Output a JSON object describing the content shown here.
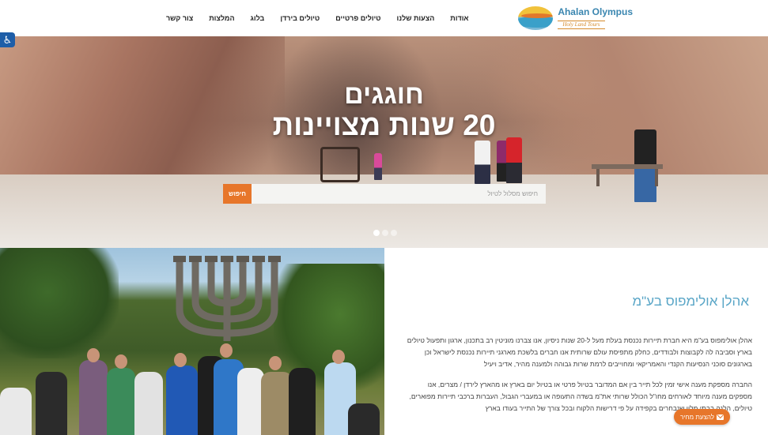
{
  "header": {
    "logo_title": "Ahalan Olympus",
    "logo_subtitle": "Holy Land Tours",
    "nav": [
      "אודות",
      "הצעות שלנו",
      "טיולים פרטיים",
      "טיולים בירדן",
      "בלוג",
      "המלצות",
      "צור קשר"
    ]
  },
  "hero": {
    "title_line1": "חוגגים",
    "title_line2": "20 שנות מצויינות",
    "search_placeholder": "חיפוש מסלול לטיול",
    "search_button": "חיפוש",
    "slides_count": 3,
    "active_slide": 1
  },
  "about": {
    "title": "אהלן אולימפוס בע\"מ",
    "p1": "אהלן אולימפוס בע\"מ היא חברת תיירות נכנסת בעלת מעל ל-20 שנות ניסיון, אנו צברנו מוניטין רב בתכנון, ארגון ותפעול טיולים בארץ וסביבה לה לקבוצות ולבודדים, כחלק מתפיסת עולם שרותית אנו חברים בלשכת מארגני תיירות נכנסת לישראל וכן בארגונים סוכני הנסיעות הקנדי והאמריקאי ומחוייבים לרמת שרות גבוהה ולמענה מהיר, אדיב ויעיל",
    "p2": "החברה מספקת מענה אישי זמין לכל תייר בין אם המדובר בטיול פרטי או בטיול יום בארץ או מהארץ לירדן / מצרים, אנו מספקים מענה מיוחד לאורחים מחו\"ל הכולל שרותי את\"מ בשדה התעופה או במעברי הגבול, העברות ברכבי תיירות מפוארים, טיולים, הלנה בבתי מלון שנבחרים בקפידה על פי דרישות הלקוח ובכל צורך של התייר בעודו בארץ"
  },
  "floating": {
    "quote_label": "להצעת מחיר",
    "accessibility_icon": "accessibility-icon",
    "envelope_icon": "envelope-icon"
  },
  "colors": {
    "accent": "#e7762a",
    "title_blue": "#5aa6c7",
    "access_blue": "#1e5ea8"
  }
}
